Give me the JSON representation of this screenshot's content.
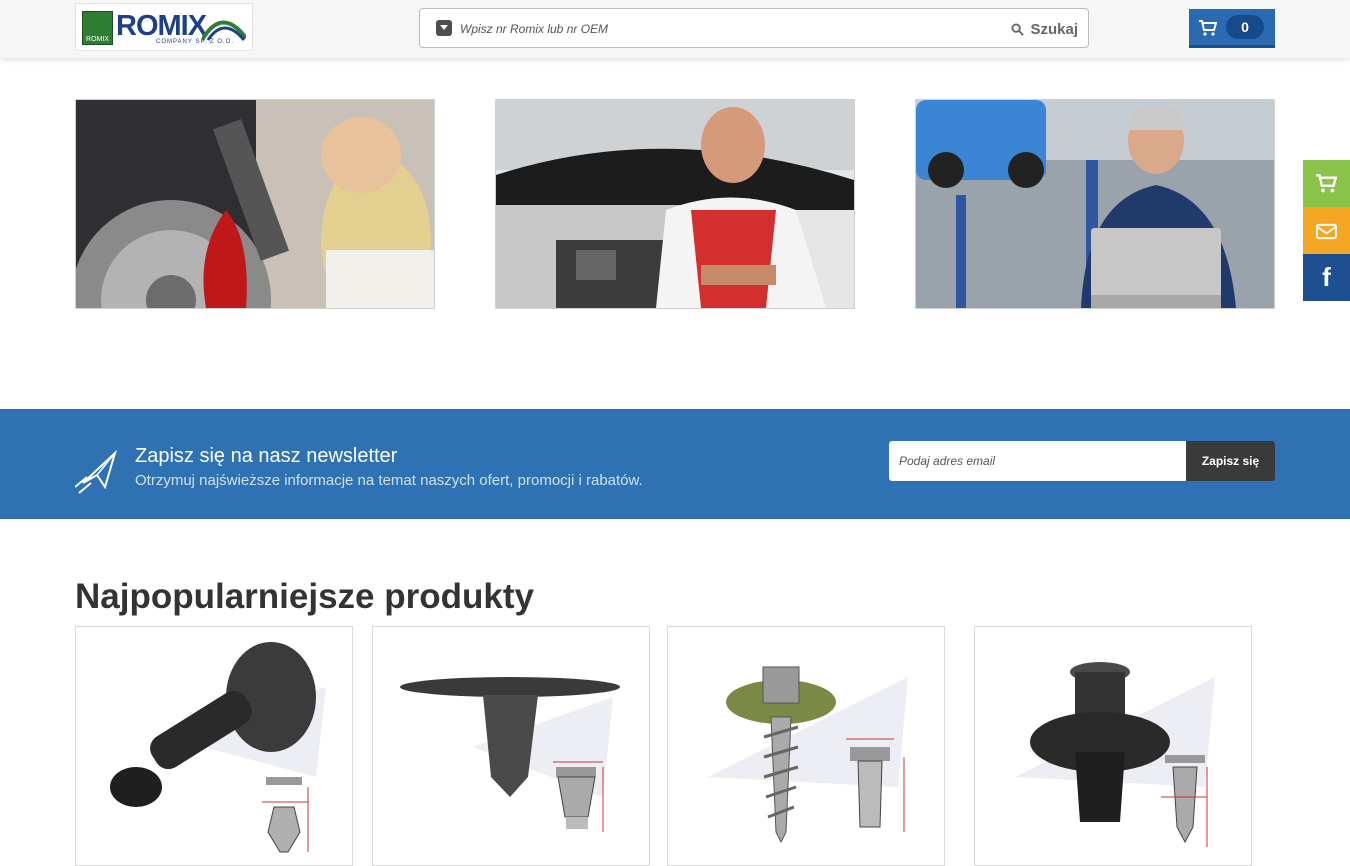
{
  "header": {
    "logo_text": "ROMIX",
    "logo_mark_text": "ROMIX",
    "logo_subtext": "COMPANY SP. Z O.O.",
    "search_placeholder": "Wpisz nr Romix lub nr OEM",
    "search_button": "Szukaj",
    "cart_count": "0"
  },
  "side_widgets": {
    "facebook_glyph": "f"
  },
  "newsletter": {
    "title": "Zapisz się na nasz newsletter",
    "subtitle": "Otrzymuj najświeższe informacje na temat naszych ofert, promocji i rabatów.",
    "email_placeholder": "Podaj adres email",
    "button": "Zapisz się"
  },
  "products_section": {
    "title": "Najpopularniejsze produkty"
  },
  "colors": {
    "brand_blue": "#2f72b3",
    "cart_green": "#8bc34a",
    "mail_orange": "#f5a623",
    "facebook_blue": "#1f4f91"
  }
}
